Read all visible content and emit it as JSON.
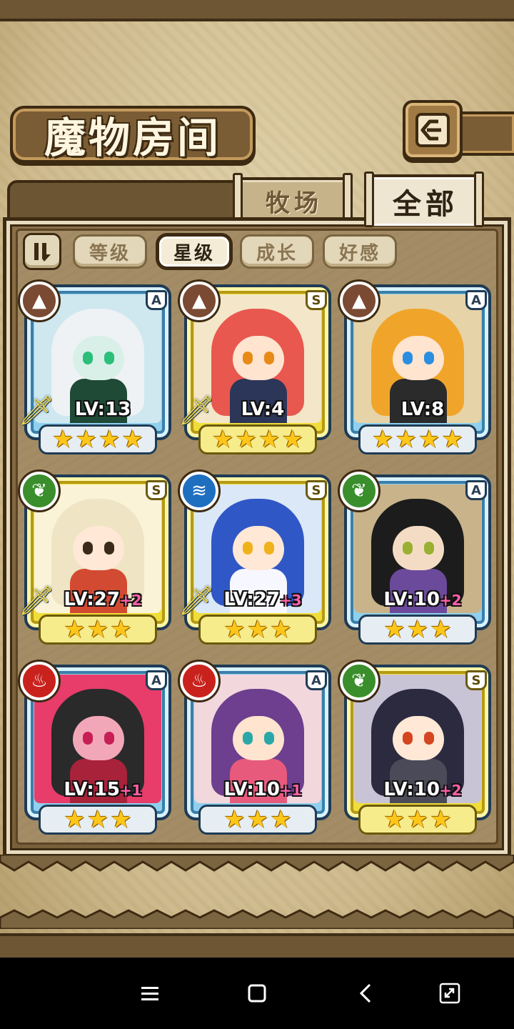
{
  "header": {
    "title": "魔物房间"
  },
  "tabs": [
    {
      "label": "牧场",
      "active": false
    },
    {
      "label": "全部",
      "active": true
    }
  ],
  "filters": [
    {
      "label": "等级",
      "active": false
    },
    {
      "label": "星级",
      "active": true
    },
    {
      "label": "成长",
      "active": false
    },
    {
      "label": "好感",
      "active": false
    }
  ],
  "monsters": [
    {
      "element": "earth",
      "rarity": "A",
      "level": "LV:13",
      "bonus": "",
      "stars": 4,
      "weapon": true,
      "hair": "#eef2f4",
      "skin": "#d9f0e8",
      "eye": "#2bbf7a",
      "outfit": "#1f4a35",
      "bg": "#cfe7ef"
    },
    {
      "element": "earth",
      "rarity": "S",
      "level": "LV:4",
      "bonus": "",
      "stars": 4,
      "weapon": true,
      "hair": "#e8584f",
      "skin": "#ffe4cf",
      "eye": "#e88a16",
      "outfit": "#2c3658",
      "bg": "#f4e6c8"
    },
    {
      "element": "earth",
      "rarity": "A",
      "level": "LV:8",
      "bonus": "",
      "stars": 4,
      "weapon": false,
      "hair": "#f0a52a",
      "skin": "#ffe4cf",
      "eye": "#2a8fe0",
      "outfit": "#2b2b2b",
      "bg": "#e6d3a8"
    },
    {
      "element": "grass",
      "rarity": "S",
      "level": "LV:27",
      "bonus": "+2",
      "stars": 3,
      "weapon": true,
      "hair": "#efe4c4",
      "skin": "#ffe8d6",
      "eye": "#3a2a1a",
      "outfit": "#d34a32",
      "bg": "#fbf3d8"
    },
    {
      "element": "water",
      "rarity": "S",
      "level": "LV:27",
      "bonus": "+3",
      "stars": 3,
      "weapon": true,
      "hair": "#2f57c6",
      "skin": "#ffe8d6",
      "eye": "#f0b21a",
      "outfit": "#f7f7ff",
      "bg": "#dbe8f7"
    },
    {
      "element": "grass",
      "rarity": "A",
      "level": "LV:10",
      "bonus": "+2",
      "stars": 3,
      "weapon": false,
      "hair": "#1c1c1c",
      "skin": "#f4dcc4",
      "eye": "#9ab032",
      "outfit": "#6b4a9b",
      "bg": "#c8b38a"
    },
    {
      "element": "fire",
      "rarity": "A",
      "level": "LV:15",
      "bonus": "+1",
      "stars": 3,
      "weapon": false,
      "hair": "#2a2a2a",
      "skin": "#f2a7b8",
      "eye": "#c71e56",
      "outfit": "#a8223a",
      "bg": "#e83c6b"
    },
    {
      "element": "fire",
      "rarity": "A",
      "level": "LV:10",
      "bonus": "+1",
      "stars": 3,
      "weapon": false,
      "hair": "#6d3f8e",
      "skin": "#ffe4cf",
      "eye": "#2aa8a8",
      "outfit": "#e85a7c",
      "bg": "#f2d7dd"
    },
    {
      "element": "grass",
      "rarity": "S",
      "level": "LV:10",
      "bonus": "+2",
      "stars": 3,
      "weapon": false,
      "hair": "#2b2a3f",
      "skin": "#ffe8d6",
      "eye": "#d4461f",
      "outfit": "#4a4a58",
      "bg": "#c9c3d6"
    }
  ],
  "icons": {
    "back": "back-arrow-icon",
    "sort": "sort-toggle-icon",
    "element_earth": "mountain-icon",
    "element_grass": "leaf-icon",
    "element_water": "water-waves-icon",
    "element_fire": "flame-icon",
    "weapon": "sword-icon",
    "star": "star-icon"
  },
  "system_nav": [
    "menu-icon",
    "home-icon",
    "back-icon",
    "fullscreen-icon"
  ]
}
